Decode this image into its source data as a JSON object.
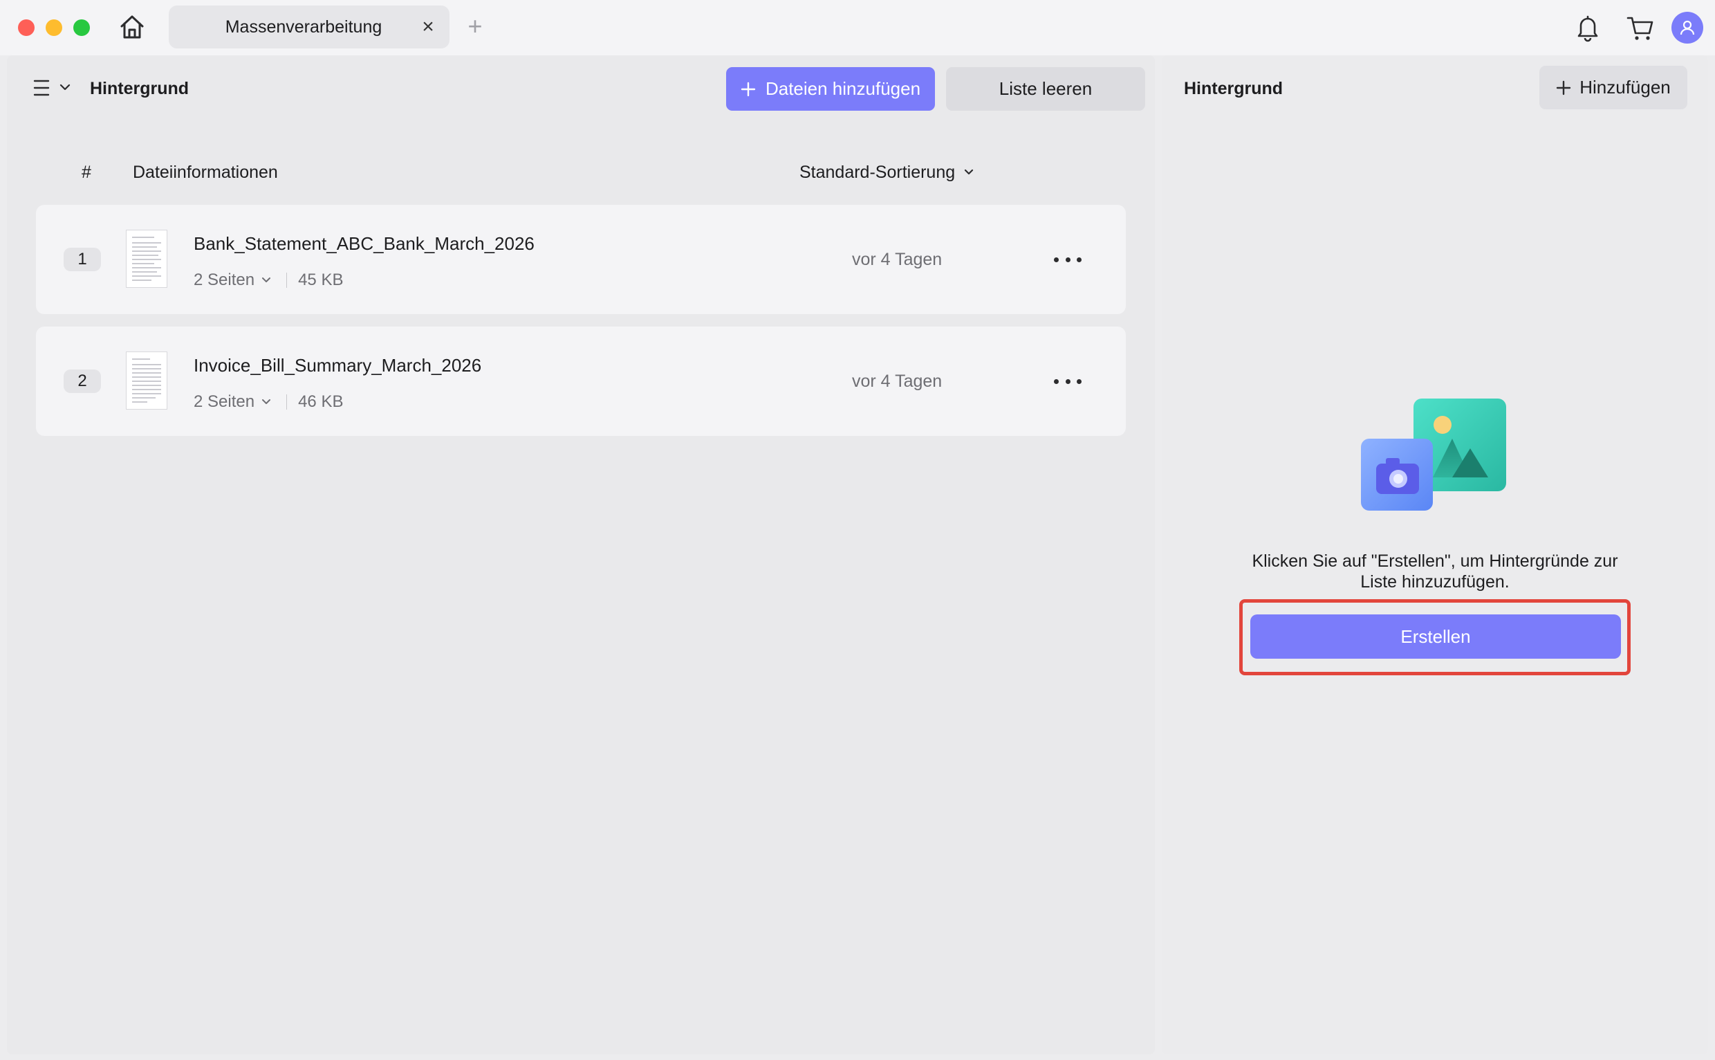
{
  "tab": {
    "title": "Massenverarbeitung",
    "close": "×",
    "add": "+"
  },
  "left": {
    "title": "Hintergrund",
    "add_files_label": "Dateien hinzufügen",
    "clear_label": "Liste leeren",
    "columns": {
      "number": "#",
      "info": "Dateiinformationen"
    },
    "sort_label": "Standard-Sortierung",
    "files": [
      {
        "index": "1",
        "name": "Bank_Statement_ABC_Bank_March_2026",
        "pages": "2 Seiten",
        "size": "45 KB",
        "date": "vor 4 Tagen"
      },
      {
        "index": "2",
        "name": "Invoice_Bill_Summary_March_2026",
        "pages": "2 Seiten",
        "size": "46 KB",
        "date": "vor 4 Tagen"
      }
    ]
  },
  "right": {
    "title": "Hintergrund",
    "add_label": "Hinzufügen",
    "empty_message": "Klicken Sie auf \"Erstellen\", um Hintergründe zur Liste hinzuzufügen.",
    "create_label": "Erstellen"
  },
  "colors": {
    "accent": "#7b7cfa",
    "highlight": "#e2453c"
  },
  "icons": [
    "home-icon",
    "bell-icon",
    "cart-icon",
    "user-icon",
    "menu-icon",
    "plus-icon",
    "chevron-down-icon",
    "more-icon",
    "document-thumbnail",
    "image-camera-illustration"
  ]
}
